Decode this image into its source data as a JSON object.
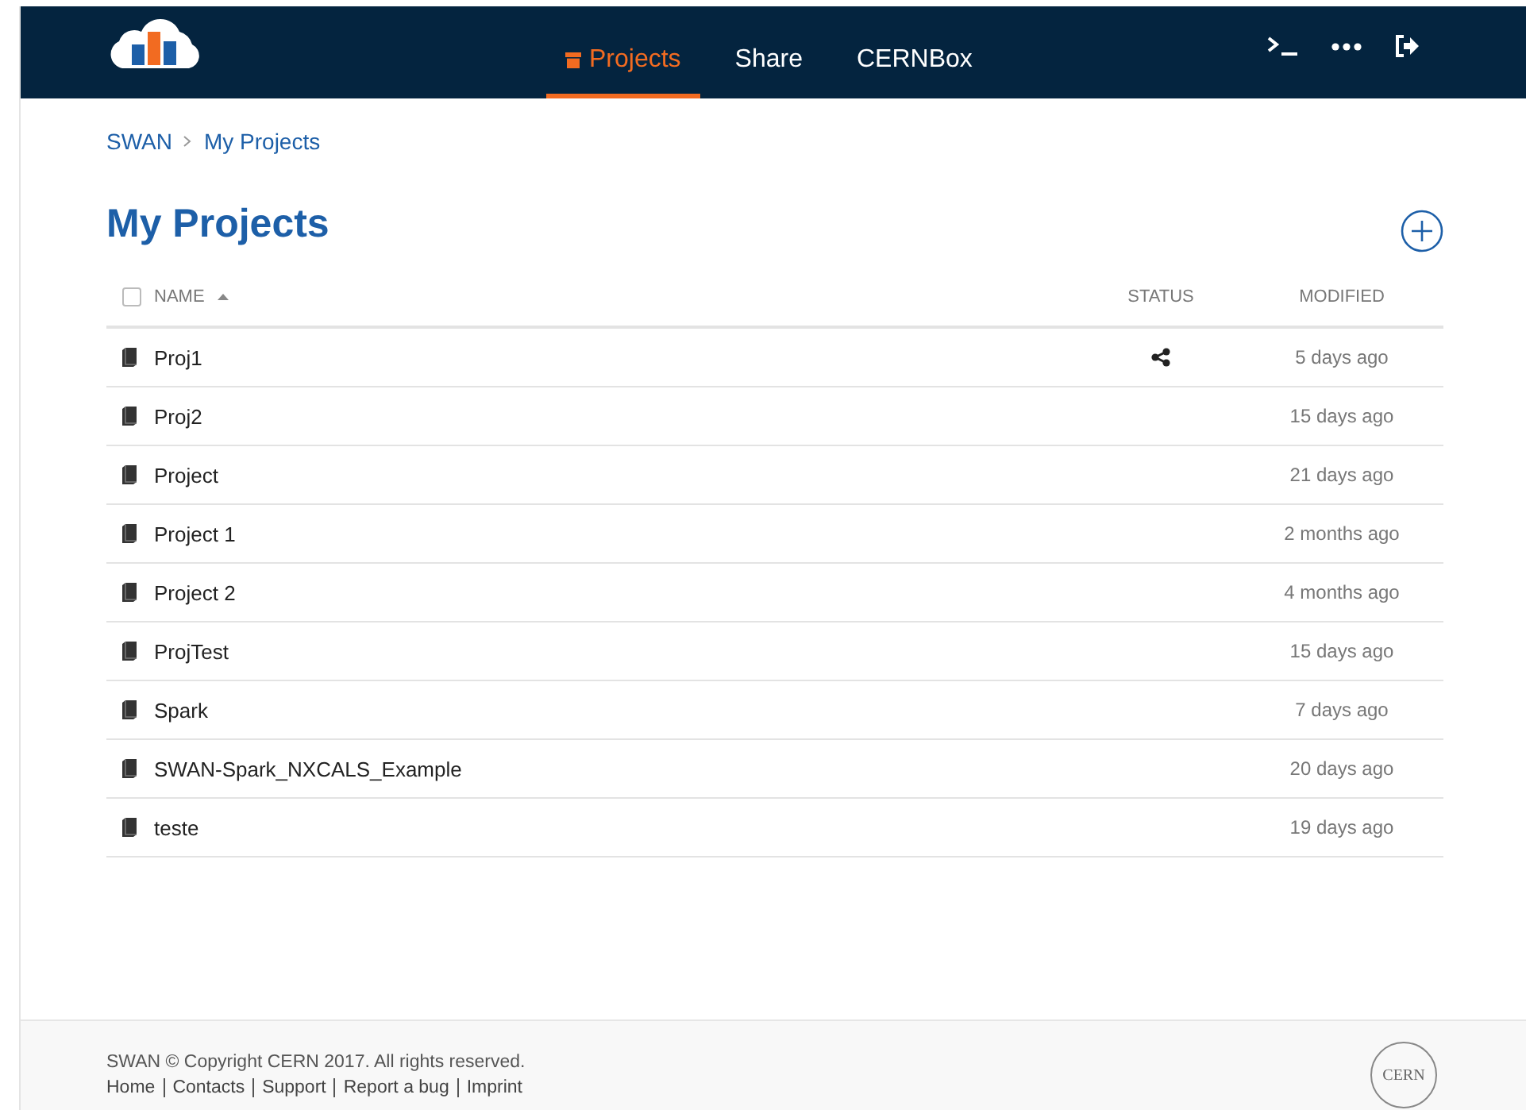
{
  "navbar": {
    "tabs": [
      {
        "label": "Projects",
        "selected": true
      },
      {
        "label": "Share",
        "selected": false
      },
      {
        "label": "CERNBox",
        "selected": false
      }
    ]
  },
  "breadcrumb": [
    "SWAN",
    "My Projects"
  ],
  "page_title": "My Projects",
  "table": {
    "select_all": {
      "checked": false
    },
    "columns": [
      {
        "label": "NAME",
        "sort_ascending": true
      },
      {
        "label": "STATUS"
      },
      {
        "label": "MODIFIED"
      }
    ],
    "rows": [
      {
        "name": "Proj1",
        "shared": true,
        "modified": "5 days ago"
      },
      {
        "name": "Proj2",
        "shared": false,
        "modified": "15 days ago"
      },
      {
        "name": "Project",
        "shared": false,
        "modified": "21 days ago"
      },
      {
        "name": "Project 1",
        "shared": false,
        "modified": "2 months ago"
      },
      {
        "name": "Project 2",
        "shared": false,
        "modified": "4 months ago"
      },
      {
        "name": "ProjTest",
        "shared": false,
        "modified": "15 days ago"
      },
      {
        "name": "Spark",
        "shared": false,
        "modified": "7 days ago"
      },
      {
        "name": "SWAN-Spark_NXCALS_Example",
        "shared": false,
        "modified": "20 days ago"
      },
      {
        "name": "teste",
        "shared": false,
        "modified": "19 days ago"
      }
    ]
  },
  "footer": {
    "copyright": "SWAN © Copyright CERN 2017. All rights reserved.",
    "links": [
      "Home",
      "Contacts",
      "Support",
      "Report a bug",
      "Imprint"
    ],
    "logo_text": "CERN"
  }
}
